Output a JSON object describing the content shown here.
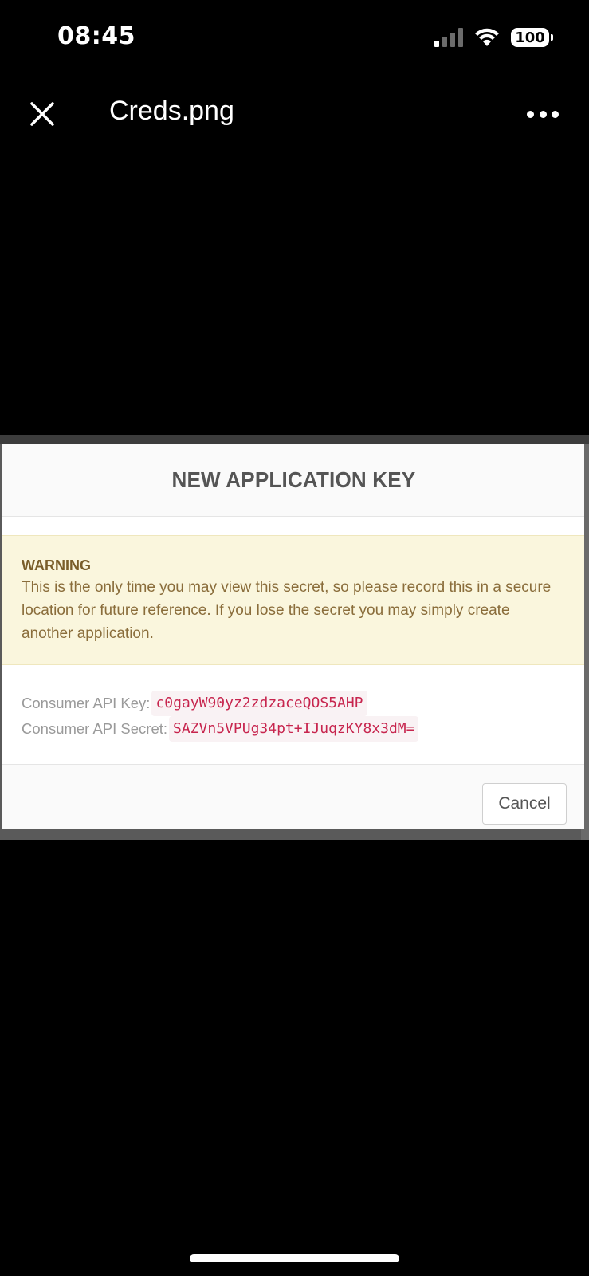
{
  "status_bar": {
    "time": "08:45",
    "battery": "100",
    "icons": [
      "signal-icon",
      "wifi-icon",
      "battery-icon"
    ]
  },
  "viewer": {
    "file_name": "Creds.png",
    "icons": [
      "close-icon",
      "more-icon"
    ]
  },
  "screenshot": {
    "modal": {
      "title": "NEW APPLICATION KEY",
      "warning": {
        "heading": "WARNING",
        "text": "This is the only time you may view this secret, so please record this in a secure location for future reference. If you lose the secret you may simply create another application."
      },
      "credentials": [
        {
          "label": "Consumer API Key:",
          "value": "c0gayW90yz2zdzaceQOS5AHP"
        },
        {
          "label": "Consumer API Secret:",
          "value": "SAZVn5VPUg34pt+IJuqzKY8x3dM="
        }
      ],
      "cancel_label": "Cancel"
    },
    "colors": {
      "warning_bg": "#faf6dd",
      "warning_text": "#8a6d3b",
      "code_text": "#c7254e",
      "code_bg": "#f9f2f4"
    }
  }
}
